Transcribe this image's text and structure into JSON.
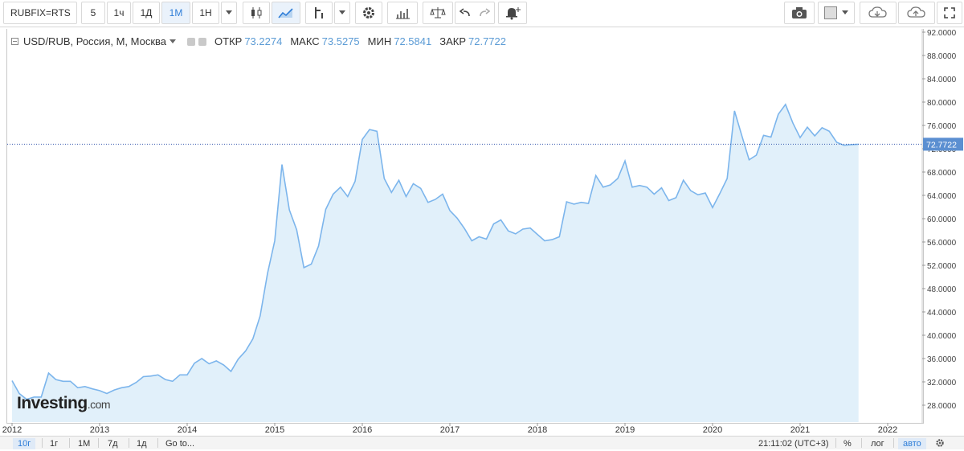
{
  "toolbar": {
    "symbol": "RUBFIX=RTS",
    "intervals": [
      "5",
      "1ч",
      "1Д",
      "1М",
      "1Н"
    ],
    "active_interval": "1М"
  },
  "legend": {
    "name": "USD/RUB, Россия, М, Москва",
    "open_label": "ОТКР",
    "open_value": "73.2274",
    "high_label": "МАКС",
    "high_value": "73.5275",
    "low_label": "МИН",
    "low_value": "72.5841",
    "close_label": "ЗАКР",
    "close_value": "72.7722"
  },
  "logo": {
    "text": "Investing",
    "suffix": ".com"
  },
  "bottom": {
    "ranges": [
      "10г",
      "1г",
      "1М",
      "7д",
      "1д"
    ],
    "active_range": "10г",
    "goto": "Go to...",
    "time": "21:11:02 (UTC+3)",
    "percent": "%",
    "log": "лог",
    "auto": "авто"
  },
  "colors": {
    "line": "#7cb5ec",
    "area": "#e1f0fa",
    "accent": "#2f7ed8",
    "price_tag": "#5b8fd1"
  },
  "chart_data": {
    "type": "area",
    "title": "USD/RUB, Россия, М, Москва",
    "xlabel": "",
    "ylabel": "",
    "x_ticks": [
      "2012",
      "2013",
      "2014",
      "2015",
      "2016",
      "2017",
      "2018",
      "2019",
      "2020",
      "2021",
      "2022"
    ],
    "y_ticks": [
      "28.0000",
      "32.0000",
      "36.0000",
      "40.0000",
      "44.0000",
      "48.0000",
      "52.0000",
      "56.0000",
      "60.0000",
      "64.0000",
      "68.0000",
      "72.0000",
      "76.0000",
      "80.0000",
      "84.0000",
      "88.0000",
      "92.0000"
    ],
    "ylim": [
      26.0,
      92.0
    ],
    "xlim": [
      2012.0,
      2022.5
    ],
    "last_price_label": "72.7722",
    "last_price": 72.7722,
    "grid": false,
    "x": [
      2012.0,
      2012.083,
      2012.167,
      2012.25,
      2012.333,
      2012.417,
      2012.5,
      2012.583,
      2012.667,
      2012.75,
      2012.833,
      2012.917,
      2013.0,
      2013.083,
      2013.167,
      2013.25,
      2013.333,
      2013.417,
      2013.5,
      2013.583,
      2013.667,
      2013.75,
      2013.833,
      2013.917,
      2014.0,
      2014.083,
      2014.167,
      2014.25,
      2014.333,
      2014.417,
      2014.5,
      2014.583,
      2014.667,
      2014.75,
      2014.833,
      2014.917,
      2015.0,
      2015.083,
      2015.167,
      2015.25,
      2015.333,
      2015.417,
      2015.5,
      2015.583,
      2015.667,
      2015.75,
      2015.833,
      2015.917,
      2016.0,
      2016.083,
      2016.167,
      2016.25,
      2016.333,
      2016.417,
      2016.5,
      2016.583,
      2016.667,
      2016.75,
      2016.833,
      2016.917,
      2017.0,
      2017.083,
      2017.167,
      2017.25,
      2017.333,
      2017.417,
      2017.5,
      2017.583,
      2017.667,
      2017.75,
      2017.833,
      2017.917,
      2018.0,
      2018.083,
      2018.167,
      2018.25,
      2018.333,
      2018.417,
      2018.5,
      2018.583,
      2018.667,
      2018.75,
      2018.833,
      2018.917,
      2019.0,
      2019.083,
      2019.167,
      2019.25,
      2019.333,
      2019.417,
      2019.5,
      2019.583,
      2019.667,
      2019.75,
      2019.833,
      2019.917,
      2020.0,
      2020.083,
      2020.167,
      2020.25,
      2020.333,
      2020.417,
      2020.5,
      2020.583,
      2020.667,
      2020.75,
      2020.833,
      2020.917,
      2021.0,
      2021.083,
      2021.167,
      2021.25,
      2021.333,
      2021.417,
      2021.5,
      2021.583,
      2021.667
    ],
    "y": [
      32.2,
      30.0,
      29.0,
      29.4,
      29.4,
      33.5,
      32.4,
      32.1,
      32.1,
      31.0,
      31.2,
      30.8,
      30.5,
      30.0,
      30.6,
      31.0,
      31.2,
      31.9,
      32.9,
      33.0,
      33.2,
      32.4,
      32.1,
      33.2,
      33.2,
      35.2,
      36.0,
      35.1,
      35.6,
      34.9,
      33.8,
      35.9,
      37.3,
      39.4,
      43.3,
      50.6,
      56.2,
      69.3,
      61.5,
      58.1,
      51.6,
      52.2,
      55.3,
      61.6,
      64.2,
      65.4,
      63.8,
      66.4,
      73.6,
      75.3,
      75.0,
      66.9,
      64.5,
      66.6,
      63.8,
      66.0,
      65.2,
      62.8,
      63.3,
      64.2,
      61.4,
      60.1,
      58.3,
      56.2,
      56.9,
      56.5,
      59.1,
      59.8,
      57.9,
      57.4,
      58.2,
      58.4,
      57.3,
      56.2,
      56.4,
      56.9,
      62.9,
      62.5,
      62.8,
      62.6,
      67.4,
      65.4,
      65.8,
      66.9,
      69.9,
      65.4,
      65.7,
      65.4,
      64.2,
      65.3,
      63.1,
      63.6,
      66.6,
      64.8,
      64.1,
      64.4,
      61.9,
      64.3,
      66.9,
      78.5,
      74.3,
      70.1,
      70.9,
      74.3,
      74.0,
      77.9,
      79.6,
      76.4,
      73.9,
      75.7,
      74.2,
      75.6,
      75.0,
      73.1,
      72.6,
      72.7,
      72.77
    ]
  }
}
